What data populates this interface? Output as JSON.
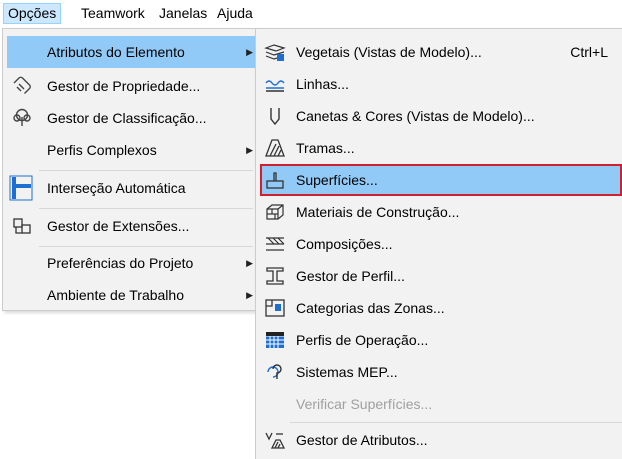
{
  "menubar": {
    "items": [
      {
        "label": "Opções"
      },
      {
        "label": "Teamwork"
      },
      {
        "label": "Janelas"
      },
      {
        "label": "Ajuda"
      }
    ]
  },
  "options_menu": {
    "items": [
      {
        "label": "Atributos do Elemento"
      },
      {
        "label": "Gestor de Propriedade..."
      },
      {
        "label": "Gestor de Classificação..."
      },
      {
        "label": "Perfis Complexos"
      },
      {
        "label": "Interseção Automática"
      },
      {
        "label": "Gestor de Extensões..."
      },
      {
        "label": "Preferências do Projeto"
      },
      {
        "label": "Ambiente de Trabalho"
      }
    ]
  },
  "attributes_submenu": {
    "items": [
      {
        "label": "Vegetais (Vistas de Modelo)...",
        "shortcut": "Ctrl+L"
      },
      {
        "label": "Linhas..."
      },
      {
        "label": "Canetas & Cores (Vistas de Modelo)..."
      },
      {
        "label": "Tramas..."
      },
      {
        "label": "Superfícies..."
      },
      {
        "label": "Materiais de Construção..."
      },
      {
        "label": "Composições..."
      },
      {
        "label": "Gestor de Perfil..."
      },
      {
        "label": "Categorias das Zonas..."
      },
      {
        "label": "Perfis de Operação..."
      },
      {
        "label": "Sistemas MEP..."
      },
      {
        "label": "Verificar Superfícies..."
      },
      {
        "label": "Gestor de Atributos..."
      }
    ]
  },
  "colors": {
    "highlight": "#91c9f7",
    "selected_outline": "#d0202e",
    "menu_background": "#f2f2f2",
    "disabled_text": "#a0a0a0"
  }
}
